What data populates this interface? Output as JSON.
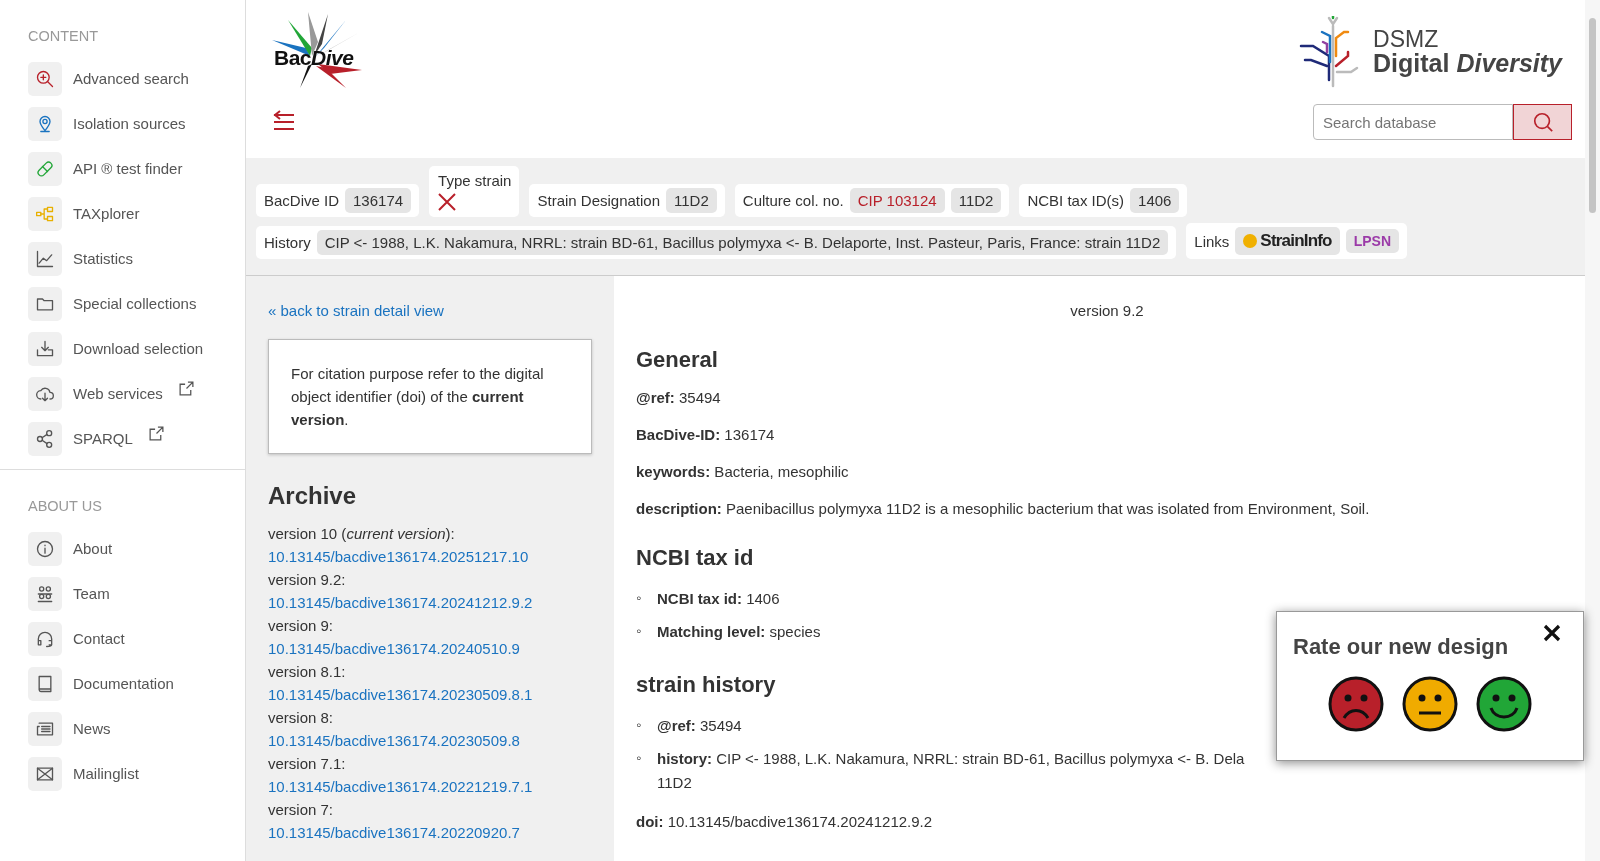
{
  "sidebar": {
    "sections": [
      {
        "heading": "CONTENT",
        "items": [
          {
            "label": "Advanced search",
            "external": false
          },
          {
            "label": "Isolation sources",
            "external": false
          },
          {
            "label": "API ® test finder",
            "external": false
          },
          {
            "label": "TAXplorer",
            "external": false
          },
          {
            "label": "Statistics",
            "external": false
          },
          {
            "label": "Special collections",
            "external": false
          },
          {
            "label": "Download selection",
            "external": false
          },
          {
            "label": "Web services",
            "external": true
          },
          {
            "label": "SPARQL",
            "external": true
          }
        ]
      },
      {
        "heading": "ABOUT US",
        "items": [
          {
            "label": "About",
            "external": false
          },
          {
            "label": "Team",
            "external": false
          },
          {
            "label": "Contact",
            "external": false
          },
          {
            "label": "Documentation",
            "external": false
          },
          {
            "label": "News",
            "external": false
          },
          {
            "label": "Mailinglist",
            "external": false
          }
        ]
      }
    ]
  },
  "header": {
    "logo": {
      "plain": "Bac",
      "italic": "Dive"
    },
    "brand_top": "DSMZ",
    "brand_bottom": "Digital *Diversity*",
    "search": {
      "placeholder": "Search database"
    }
  },
  "strain_bar": {
    "fields": [
      {
        "kind": "chips",
        "label": "BacDive ID",
        "values": [
          {
            "text": "136174",
            "linked": false
          }
        ]
      },
      {
        "kind": "flag",
        "label": "Type strain",
        "on": false
      },
      {
        "kind": "chips",
        "label": "Strain Designation",
        "values": [
          {
            "text": "11D2",
            "linked": false
          }
        ]
      },
      {
        "kind": "chips",
        "label": "Culture col. no.",
        "values": [
          {
            "text": "CIP 103124",
            "linked": true
          },
          {
            "text": "11D2",
            "linked": false
          }
        ]
      },
      {
        "kind": "chips",
        "label": "NCBI tax ID(s)",
        "values": [
          {
            "text": "1406",
            "linked": false
          }
        ]
      }
    ],
    "history": {
      "label": "History",
      "value": "CIP <- 1988, L.K. Nakamura, NRRL: strain BD-61, Bacillus polymyxa <- B. Delaporte, Inst. Pasteur, Paris, France: strain 11D2"
    },
    "links": {
      "label": "Links",
      "items": [
        {
          "text": "StrainInfo",
          "kind": "straininfo"
        },
        {
          "text": "LPSN",
          "kind": "lpsn"
        }
      ]
    }
  },
  "archive_panel": {
    "back_link": "« back to strain detail view",
    "note": "For citation purpose refer to the digital object identifier (doi) of the **current version**.",
    "title": "Archive",
    "versions": [
      {
        "label": "version 10 (*current version*):",
        "doi": "10.13145/bacdive136174.20251217.10"
      },
      {
        "label": "version 9.2:",
        "doi": "10.13145/bacdive136174.20241212.9.2"
      },
      {
        "label": "version 9:",
        "doi": "10.13145/bacdive136174.20240510.9"
      },
      {
        "label": "version 8.1:",
        "doi": "10.13145/bacdive136174.20230509.8.1"
      },
      {
        "label": "version 8:",
        "doi": "10.13145/bacdive136174.20230509.8"
      },
      {
        "label": "version 7.1:",
        "doi": "10.13145/bacdive136174.20221219.7.1"
      },
      {
        "label": "version 7:",
        "doi": "10.13145/bacdive136174.20220920.7"
      }
    ]
  },
  "content": {
    "version": "version 9.2",
    "sections": [
      {
        "title": "General",
        "kind": "fields",
        "items": [
          {
            "key": "@ref:",
            "value": "35494"
          },
          {
            "key": "BacDive-ID:",
            "value": "136174"
          },
          {
            "key": "keywords:",
            "value": "Bacteria, mesophilic"
          },
          {
            "key": "description:",
            "value": "Paenibacillus polymyxa 11D2 is a mesophilic bacterium that was isolated from Environment, Soil."
          }
        ]
      },
      {
        "title": "NCBI tax id",
        "kind": "bullets",
        "marker": "◦",
        "items": [
          {
            "key": "NCBI tax id:",
            "value": "1406"
          },
          {
            "key": "Matching level:",
            "value": "species"
          }
        ]
      },
      {
        "title": "strain history",
        "kind": "bullets",
        "marker": "◦",
        "items": [
          {
            "key": "@ref:",
            "value": "35494"
          },
          {
            "key": "history:",
            "value": "CIP <- 1988, L.K. Nakamura, NRRL: strain BD-61, Bacillus polymyxa <- B. Dela",
            "wrap": "11D2"
          }
        ]
      }
    ],
    "doi": {
      "key": "doi:",
      "value": "10.13145/bacdive136174.20241212.9.2"
    }
  },
  "rating_popup": {
    "title": "Rate our new design",
    "faces": [
      {
        "kind": "sad",
        "color": "#b8202a"
      },
      {
        "kind": "neutral",
        "color": "#f0ab00"
      },
      {
        "kind": "happy",
        "color": "#21a637"
      }
    ]
  }
}
